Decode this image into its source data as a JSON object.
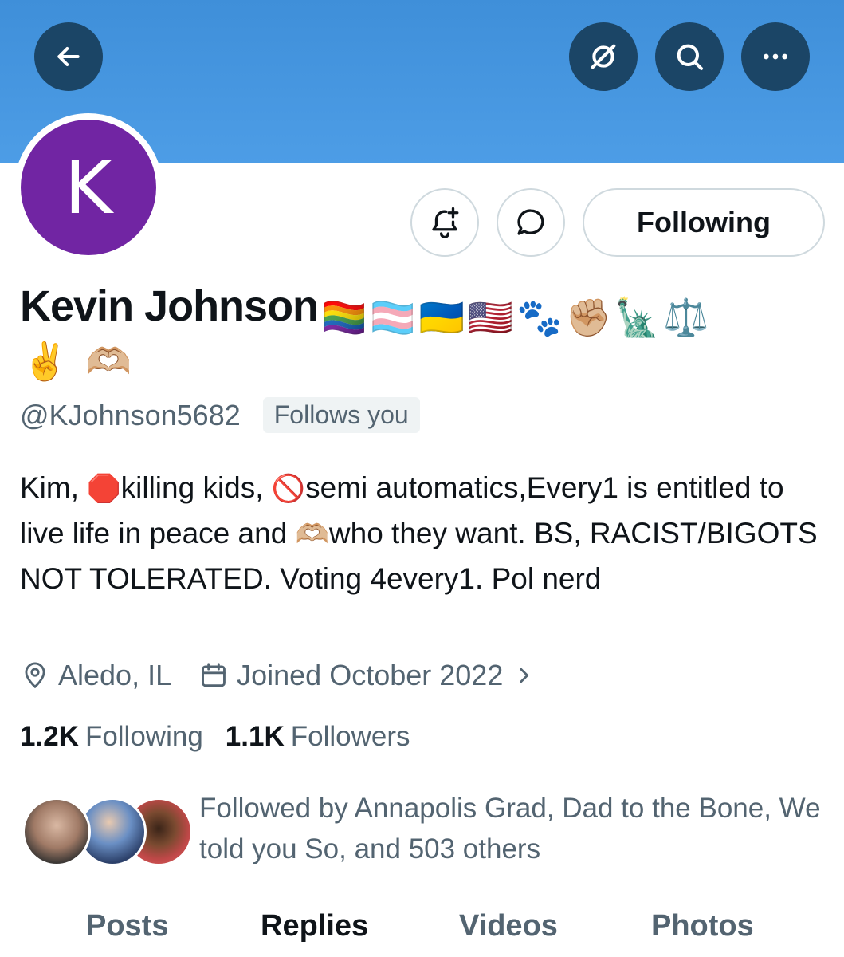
{
  "header": {
    "back_icon": "arrow-left-icon",
    "grok_icon": "grok-slash-icon",
    "search_icon": "search-icon",
    "more_icon": "more-dots-icon"
  },
  "profile": {
    "avatar_letter": "K",
    "name": "Kevin Johnson",
    "name_emojis": [
      "🏳️‍🌈",
      "🏳️‍⚧️",
      "🇺🇦",
      "🇺🇸",
      "🐾",
      "✊🏼",
      "🗽",
      "⚖️"
    ],
    "name_emojis_line2": [
      "✌️",
      "🫶🏼"
    ],
    "handle": "@KJohnson5682",
    "follows_you": "Follows you",
    "bio": {
      "part1": "Kim, ",
      "emoji1": "🛑",
      "part2": "killing kids, ",
      "emoji2": "🚫",
      "part3": "semi automatics,Every1 is entitled to live life in peace and ",
      "emoji3": "🫶🏼",
      "part4": "who they want. BS, RACIST/BIGOTS NOT TOLERATED. Voting 4every1. Pol nerd"
    },
    "location": "Aledo, IL",
    "joined": "Joined October 2022",
    "following_count": "1.2K",
    "following_label": "Following",
    "followers_count": "1.1K",
    "followers_label": "Followers",
    "followed_by": "Followed by Annapolis Grad, Dad to the Bone, We told you So, and 503 others"
  },
  "actions": {
    "notify_icon": "bell-plus-icon",
    "message_icon": "message-bubble-icon",
    "following_button": "Following"
  },
  "tabs": [
    {
      "label": "Posts",
      "active": false
    },
    {
      "label": "Replies",
      "active": true
    },
    {
      "label": "Videos",
      "active": false
    },
    {
      "label": "Photos",
      "active": false
    }
  ],
  "colors": {
    "banner": "#4d9de6",
    "avatar": "#7125a3",
    "secondary_text": "#536471"
  }
}
